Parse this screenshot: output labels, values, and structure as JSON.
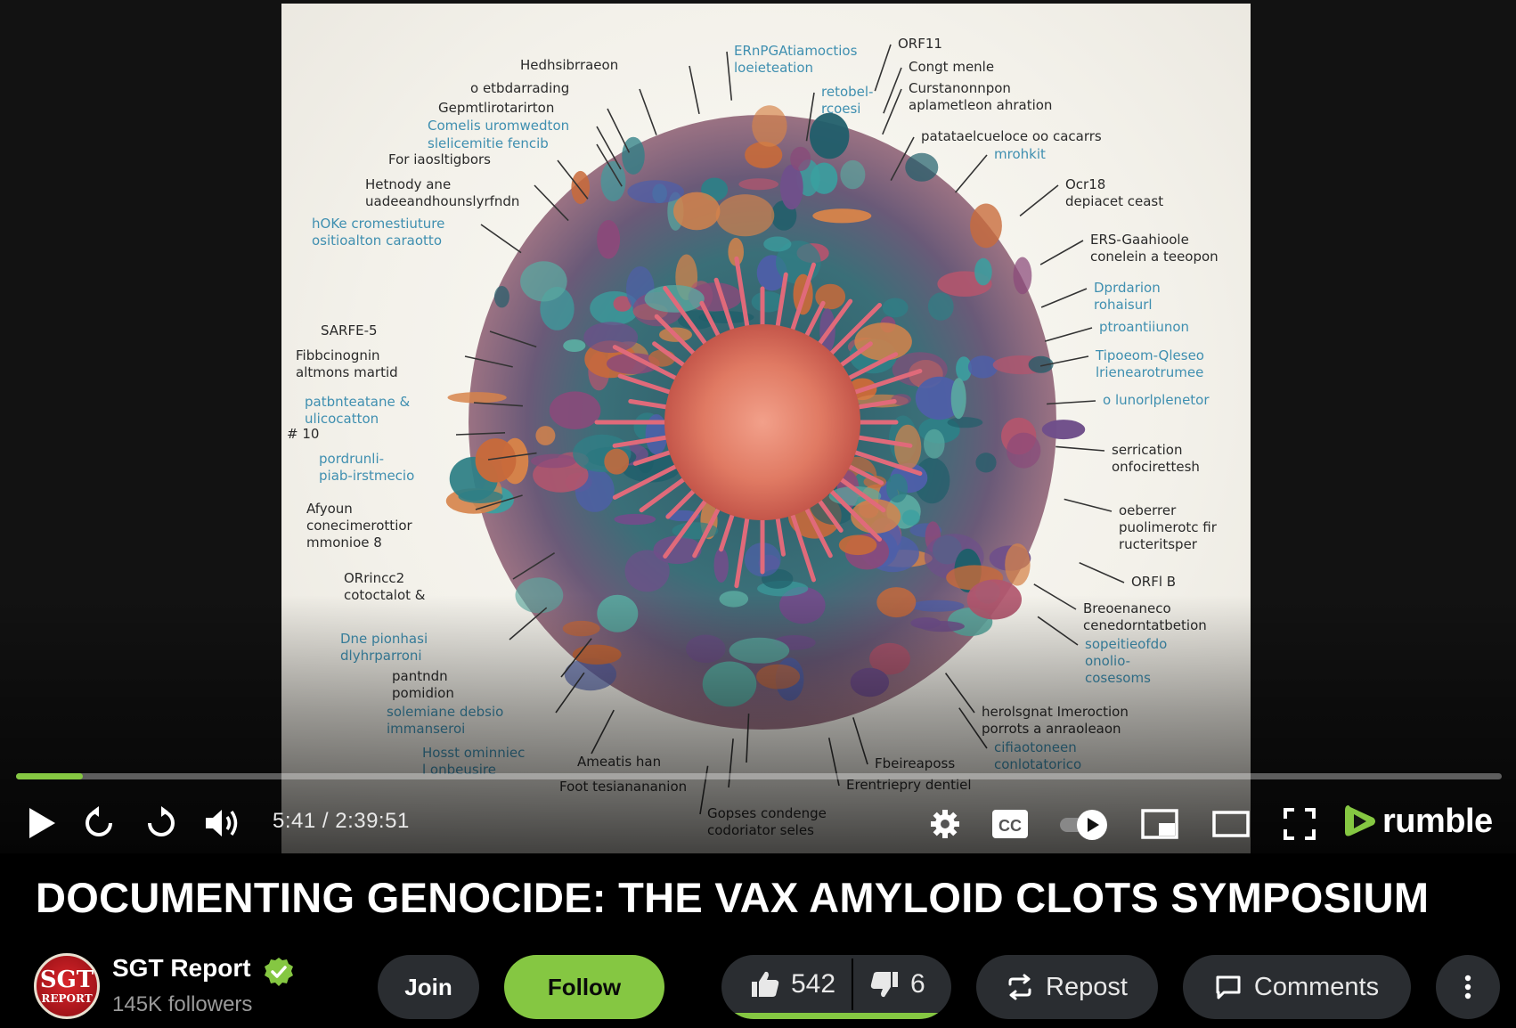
{
  "player": {
    "frame_annotations": [
      {
        "text": "Hedhsibrraeon",
        "blue": false
      },
      {
        "text": "o etbdarrading",
        "blue": false
      },
      {
        "text": "Gepmtlirotarirton",
        "blue": false
      },
      {
        "text": "Comelis uromwedton",
        "blue": true
      },
      {
        "text": "slelicemitie fencib",
        "blue": true
      },
      {
        "text": "For iaosltigbors",
        "blue": false
      },
      {
        "text": "Hetnody ane\nuadeeandhounslyrfndn",
        "blue": false
      },
      {
        "text": "hOKe cromestiuture\nositioalton caraotto",
        "blue": true
      },
      {
        "text": "SARFE-5",
        "blue": false
      },
      {
        "text": "Fibbcinognin\naltmons martid",
        "blue": false
      },
      {
        "text": "patbnteatane &\nulicocatton",
        "blue": true
      },
      {
        "text": "# 10",
        "blue": false
      },
      {
        "text": "pordrunli-\npiab-irstmecio",
        "blue": true
      },
      {
        "text": "Afyoun\nconecimerottior\nmmonioe 8",
        "blue": false
      },
      {
        "text": "ORrincc2\ncotoctalot &",
        "blue": false
      },
      {
        "text": "Dne pionhasi\ndlyhrparroni",
        "blue": true
      },
      {
        "text": "pantndn\npomidion",
        "blue": false
      },
      {
        "text": "solemiane debsio\nimmanseroi",
        "blue": true
      },
      {
        "text": "Hosst ominniec\nl onbeusire",
        "blue": true
      },
      {
        "text": "ERnPGAtiamoctios\nloeieteation",
        "blue": true
      },
      {
        "text": "ORF11",
        "blue": false
      },
      {
        "text": "Congt menle",
        "blue": false
      },
      {
        "text": "Curstanonnpon\naplametleon ahration",
        "blue": false
      },
      {
        "text": "retobel-\nrcoesi",
        "blue": true
      },
      {
        "text": "patataelcueloce oo cacarrs",
        "blue": false
      },
      {
        "text": "mrohkit",
        "blue": true
      },
      {
        "text": "Ocr18\ndepiacet ceast",
        "blue": false
      },
      {
        "text": "ERS-Gaahioole\nconelein a teeopon",
        "blue": false
      },
      {
        "text": "Dprdarion\nrohaisurl",
        "blue": true
      },
      {
        "text": "ptroantiiunon",
        "blue": true
      },
      {
        "text": "Tipoeom-Qleseo\nlrienearotrumee",
        "blue": true
      },
      {
        "text": "o lunorlplenetor",
        "blue": true
      },
      {
        "text": "serrication\nonfocirettesh",
        "blue": false
      },
      {
        "text": "oeberrer\npuolimerotc fir\nructeritsper",
        "blue": false
      },
      {
        "text": "ORFl B",
        "blue": false
      },
      {
        "text": "Breoenaneco\ncenedorntatbetion",
        "blue": false
      },
      {
        "text": "sopeitieofdo\nonolio-\ncosesoms",
        "blue": true
      },
      {
        "text": "herolsgnat Imeroction\nporrots a anraoleaon",
        "blue": false
      },
      {
        "text": "cifiaotoneen\nconlotatorico",
        "blue": true
      },
      {
        "text": "Ameatis han",
        "blue": false
      },
      {
        "text": "Fbeireaposs",
        "blue": false
      },
      {
        "text": "Foot tesianananion",
        "blue": false
      },
      {
        "text": "Erentriepry dentiel",
        "blue": false
      },
      {
        "text": "Gopses condenge\ncodoriator seles",
        "blue": false
      }
    ],
    "progress": {
      "fraction": 0.045
    },
    "time_display": "5:41 / 2:39:51",
    "brand_word": "rumble",
    "accent": "#85c742",
    "icons": [
      "play-icon",
      "rewind-icon",
      "forward-icon",
      "volume-icon",
      "settings-icon",
      "cc-icon",
      "autoplay-toggle-icon",
      "miniplayer-icon",
      "theater-icon",
      "fullscreen-icon"
    ]
  },
  "video": {
    "title": "DOCUMENTING GENOCIDE: THE VAX AMYLOID CLOTS SYMPOSIUM"
  },
  "channel": {
    "avatar_top": "SGT",
    "avatar_bottom": "REPORT",
    "name": "SGT Report",
    "followers": "145K followers",
    "verified": true
  },
  "actions": {
    "join": "Join",
    "follow": "Follow",
    "likes": "542",
    "dislikes": "6",
    "like_fraction": 0.989,
    "repost": "Repost",
    "comments": "Comments"
  }
}
